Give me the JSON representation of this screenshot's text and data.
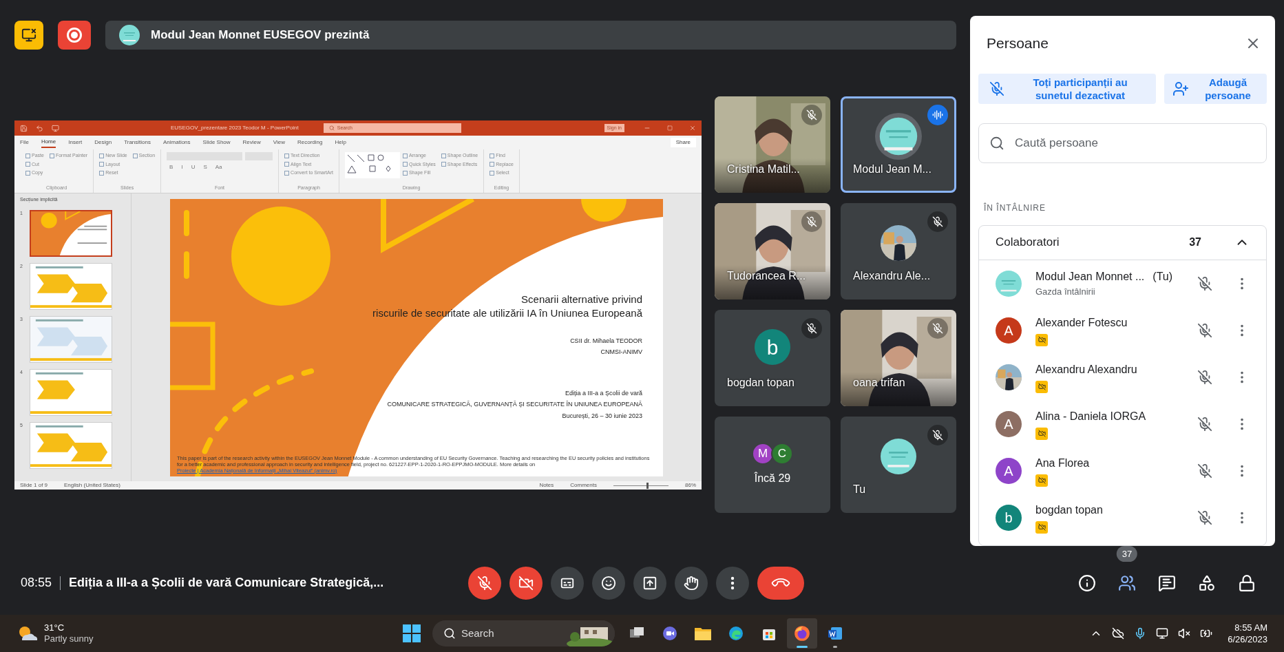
{
  "top_bar": {
    "presenting": "Modul Jean Monnet EUSEGOV prezintă"
  },
  "presentation": {
    "title_bar": {
      "title": "EUSEGOV_prezentare 2023 Teodor M  -  PowerPoint",
      "search": "Search",
      "sign_in": "Sign in"
    },
    "ribbon_tabs": [
      {
        "label": "File",
        "selected": false
      },
      {
        "label": "Home",
        "selected": true
      },
      {
        "label": "Insert",
        "selected": false
      },
      {
        "label": "Design",
        "selected": false
      },
      {
        "label": "Transitions",
        "selected": false
      },
      {
        "label": "Animations",
        "selected": false
      },
      {
        "label": "Slide Show",
        "selected": false
      },
      {
        "label": "Review",
        "selected": false
      },
      {
        "label": "View",
        "selected": false
      },
      {
        "label": "Recording",
        "selected": false
      },
      {
        "label": "Help",
        "selected": false
      }
    ],
    "share": "Share",
    "ribbon_groups": [
      {
        "kind": "tools",
        "label": "Clipboard",
        "items": [
          "Paste",
          "Cut",
          "Copy",
          "Format Painter"
        ]
      },
      {
        "kind": "tools",
        "label": "Slides",
        "items": [
          "New Slide",
          "Layout",
          "Reset",
          "Section"
        ]
      },
      {
        "kind": "font",
        "label": "Font",
        "items": [
          "B",
          "I",
          "U",
          "S",
          "Aa"
        ]
      },
      {
        "kind": "tools",
        "label": "Paragraph",
        "items": [
          "Text Direction",
          "Align Text",
          "Convert to SmartArt"
        ]
      },
      {
        "kind": "drawing",
        "label": "Drawing",
        "items": [
          "Arrange",
          "Quick Styles",
          "Shape Fill",
          "Shape Outline",
          "Shape Effects"
        ]
      },
      {
        "kind": "tools",
        "label": "Editing",
        "items": [
          "Find",
          "Replace",
          "Select"
        ]
      }
    ],
    "section": "Secțiune implicită",
    "thumbnails": [
      {
        "number": "1",
        "selected": true
      },
      {
        "number": "2",
        "selected": false
      },
      {
        "number": "3",
        "selected": false
      },
      {
        "number": "4",
        "selected": false
      },
      {
        "number": "5",
        "selected": false
      }
    ],
    "slide": {
      "title_lines": [
        "Scenarii alternative privind",
        "riscurile de securitate ale utilizării IA în Uniunea Europeană"
      ],
      "author": "CSII dr. Mihaela TEODOR",
      "org": "CNMSI-ANIMV",
      "edition": "Ediția a III-a a Școlii de vară",
      "event": "COMUNICARE STRATEGICĂ, GUVERNANȚĂ ȘI SECURITATE ÎN UNIUNEA EUROPEANĂ",
      "place_date": "București, 26 – 30 iunie 2023",
      "footnote": "This paper is part of the research activity within the EUSEGOV Jean Monnet Module - A common understanding of EU Security Governance. Teaching and researching the EU security policies and institutions for a better academic and professional approach in security and intelligence field, project no. 621227-EPP-1-2020-1-RO-EPPJMO-MODULE. More details on",
      "footnote_link": "Proiecte | Academia Națională de Informații „Mihai Viteazul” (animv.ro)"
    },
    "status_bar": {
      "slide": "Slide 1 of 9",
      "language": "English (United States)",
      "notes": "Notes",
      "comments": "Comments",
      "zoom_slider": {
        "level": 0.6
      },
      "zoom": "86%"
    }
  },
  "tiles": [
    {
      "kind": "video",
      "name": "Cristina Matil...",
      "muted": true,
      "speaking": false
    },
    {
      "kind": "avatar",
      "name": "Modul Jean M...",
      "muted": false,
      "speaking": true
    },
    {
      "kind": "video",
      "name": "Tudorancea R...",
      "muted": true,
      "speaking": false
    },
    {
      "kind": "avatar",
      "name": "Alexandru Ale...",
      "muted": true,
      "speaking": false
    },
    {
      "kind": "letter",
      "letter": "b",
      "color": "#12857a",
      "name": "bogdan topan",
      "muted": true,
      "speaking": false
    },
    {
      "kind": "video",
      "name": "oana trifan",
      "muted": true,
      "speaking": false
    },
    {
      "kind": "more",
      "letters": [
        {
          "letter": "M",
          "color": "#a142c4"
        },
        {
          "letter": "C",
          "color": "#2e7d32"
        }
      ],
      "name": "Încă 29",
      "muted": false,
      "speaking": false
    },
    {
      "kind": "avatar",
      "name": "Tu",
      "muted": true,
      "speaking": false
    }
  ],
  "people_panel": {
    "title": "Persoane",
    "mute_all": "Toți participanții au sunetul dezactivat",
    "add_people": "Adaugă persoane",
    "search_placeholder": "Caută persoane",
    "section": "ÎN ÎNTÂLNIRE",
    "group": {
      "label": "Colaboratori",
      "count": "37",
      "expanded": true
    },
    "people": [
      {
        "kind": "picture",
        "name": "Modul Jean Monnet ...",
        "you": "(Tu)",
        "subtitle": "Gazda întâlnirii",
        "camera_off": false,
        "muted": true
      },
      {
        "kind": "letter",
        "letter": "A",
        "color": "#c5391a",
        "name": "Alexander Fotescu",
        "camera_off": true,
        "muted": true
      },
      {
        "kind": "picture",
        "name": "Alexandru Alexandru",
        "camera_off": true,
        "muted": true
      },
      {
        "kind": "letter",
        "letter": "A",
        "color": "#8d6e63",
        "name": "Alina - Daniela IORGA",
        "camera_off": true,
        "muted": true
      },
      {
        "kind": "letter",
        "letter": "A",
        "color": "#8e44c9",
        "name": "Ana Florea",
        "camera_off": true,
        "muted": true
      },
      {
        "kind": "letter",
        "letter": "b",
        "color": "#12857a",
        "name": "bogdan topan",
        "camera_off": true,
        "muted": true
      }
    ]
  },
  "bottom_bar": {
    "time": "08:55",
    "meeting_title": "Ediția a III-a a Școlii de vară Comunicare Strategică,...",
    "controls": [
      {
        "kind": "mic",
        "on": false
      },
      {
        "kind": "camera",
        "on": false
      },
      {
        "kind": "captions",
        "on": false
      },
      {
        "kind": "emoji"
      },
      {
        "kind": "present"
      },
      {
        "kind": "hand",
        "on": false
      },
      {
        "kind": "more"
      },
      {
        "kind": "end"
      }
    ],
    "side_icons": [
      {
        "kind": "info",
        "selected": false
      },
      {
        "kind": "people",
        "selected": true,
        "badge": "37"
      },
      {
        "kind": "chat",
        "selected": false
      },
      {
        "kind": "activities",
        "selected": false
      },
      {
        "kind": "lock",
        "selected": false
      }
    ]
  },
  "taskbar": {
    "temperature": "31°C",
    "weather": "Partly sunny",
    "search": "Search",
    "apps": [
      {
        "kind": "taskview",
        "active": false,
        "running": false
      },
      {
        "kind": "chat",
        "active": false,
        "running": false
      },
      {
        "kind": "folder",
        "active": false,
        "running": false
      },
      {
        "kind": "edge",
        "active": false,
        "running": false
      },
      {
        "kind": "store",
        "active": false,
        "running": false
      },
      {
        "kind": "firefox",
        "active": true,
        "running": true
      },
      {
        "kind": "word",
        "active": false,
        "running": true
      }
    ],
    "time": "8:55 AM",
    "date": "6/26/2023"
  }
}
